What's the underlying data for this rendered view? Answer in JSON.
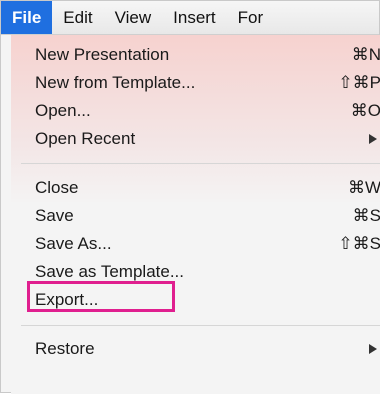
{
  "menubar": {
    "items": [
      "File",
      "Edit",
      "View",
      "Insert",
      "For"
    ]
  },
  "dropdown": {
    "group1": [
      {
        "label": "New Presentation",
        "shortcut": "⌘N"
      },
      {
        "label": "New from Template...",
        "shortcut": "⇧⌘P"
      },
      {
        "label": "Open...",
        "shortcut": "⌘O"
      },
      {
        "label": "Open Recent",
        "submenu": true
      }
    ],
    "group2": [
      {
        "label": "Close",
        "shortcut": "⌘W"
      },
      {
        "label": "Save",
        "shortcut": "⌘S"
      },
      {
        "label": "Save As...",
        "shortcut": "⇧⌘S"
      },
      {
        "label": "Save as Template...",
        "shortcut": ""
      },
      {
        "label": "Export...",
        "shortcut": "",
        "highlighted": true
      }
    ],
    "group3": [
      {
        "label": "Restore",
        "submenu": true
      }
    ]
  },
  "colors": {
    "active_menu": "#1f6fe0",
    "highlight_box": "#e01f8f"
  }
}
